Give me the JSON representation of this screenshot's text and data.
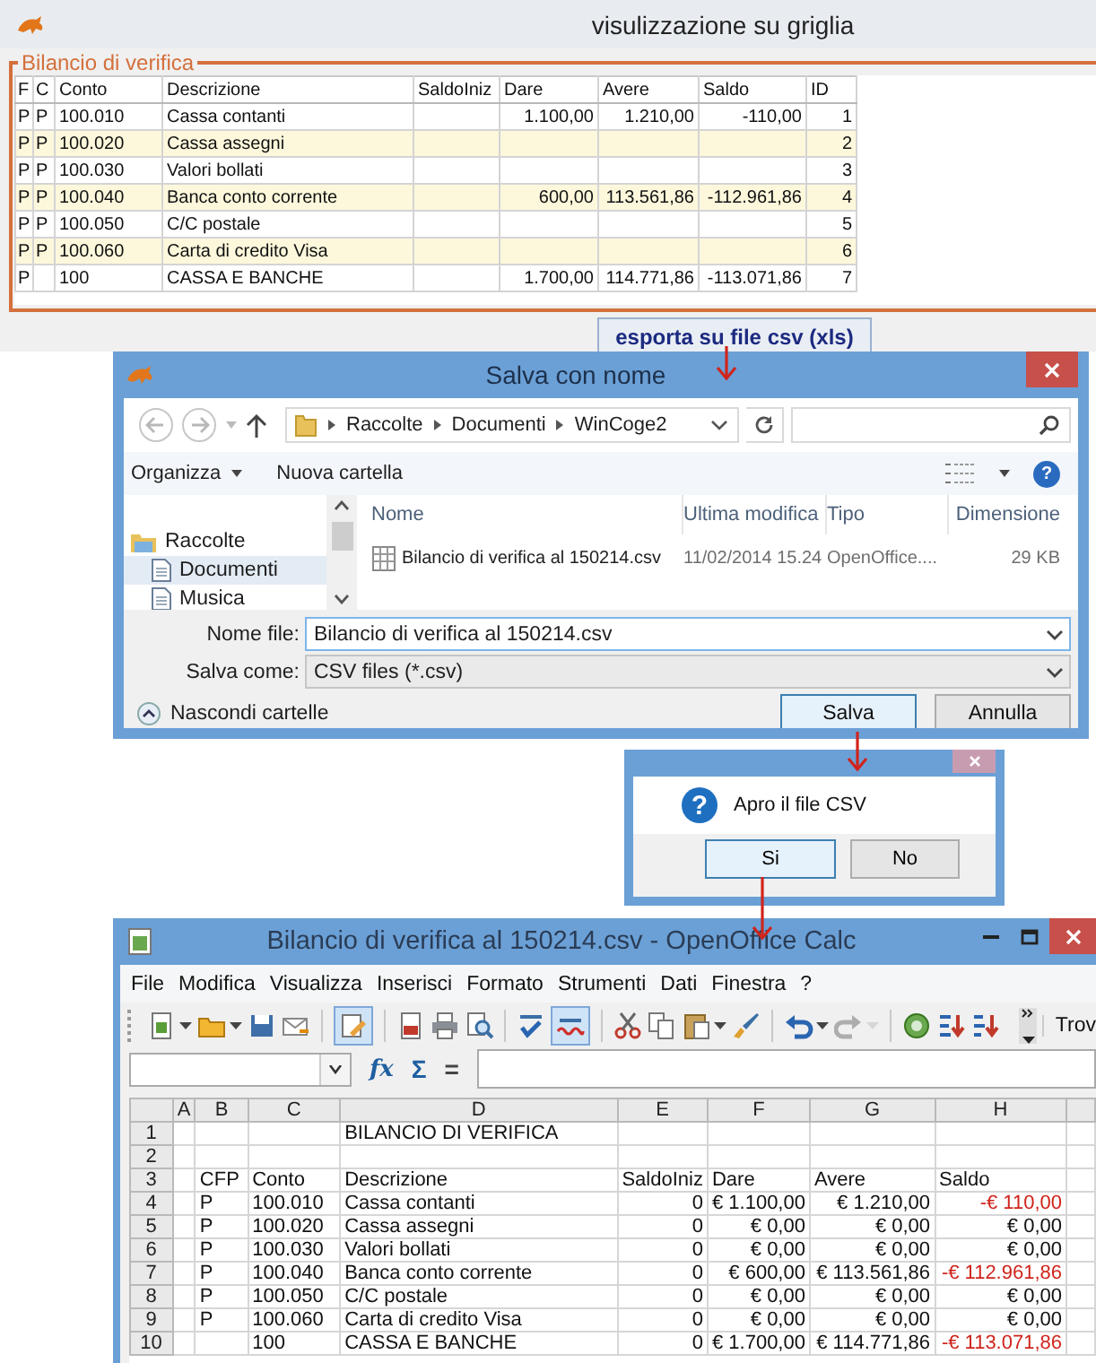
{
  "main_window": {
    "title": "visulizzazione su griglia",
    "group_title": "Bilancio di verifica",
    "columns": [
      "F",
      "C",
      "Conto",
      "Descrizione",
      "SaldoIniz",
      "Dare",
      "Avere",
      "Saldo",
      "ID"
    ],
    "rows": [
      {
        "f": "P",
        "c": "P",
        "conto": "100.010",
        "descrizione": "Cassa contanti",
        "dare": "1.100,00",
        "avere": "1.210,00",
        "saldo": "-110,00",
        "id": "1",
        "highlighted": false
      },
      {
        "f": "P",
        "c": "P",
        "conto": "100.020",
        "descrizione": "Cassa assegni",
        "id": "2",
        "highlighted": true
      },
      {
        "f": "P",
        "c": "P",
        "conto": "100.030",
        "descrizione": "Valori bollati",
        "id": "3",
        "highlighted": false
      },
      {
        "f": "P",
        "c": "P",
        "conto": "100.040",
        "descrizione": "Banca conto corrente",
        "dare": "600,00",
        "avere": "113.561,86",
        "saldo": "-112.961,86",
        "id": "4",
        "highlighted": true
      },
      {
        "f": "P",
        "c": "P",
        "conto": "100.050",
        "descrizione": "C/C postale",
        "id": "5",
        "highlighted": false
      },
      {
        "f": "P",
        "c": "P",
        "conto": "100.060",
        "descrizione": "Carta di credito Visa",
        "id": "6",
        "highlighted": true
      },
      {
        "f": "P",
        "conto": "100",
        "descrizione": "CASSA E BANCHE",
        "dare": "1.700,00",
        "avere": "114.771,86",
        "saldo": "-113.071,86",
        "id": "7",
        "highlighted": false
      }
    ],
    "export_button": "esporta su file csv (xls)"
  },
  "save_dialog": {
    "title": "Salva con nome",
    "path": [
      "Raccolte",
      "Documenti",
      "WinCoge2"
    ],
    "organize": "Organizza",
    "new_folder": "Nuova cartella",
    "help_glyph": "?",
    "nav": [
      {
        "label": "Raccolte",
        "selected": false,
        "children": [
          {
            "label": "Documenti",
            "selected": true
          },
          {
            "label": "Musica",
            "selected": false
          }
        ]
      }
    ],
    "file_columns": [
      "Nome",
      "Ultima modifica",
      "Tipo",
      "Dimensione"
    ],
    "files": [
      {
        "name": "Bilancio di verifica al 150214.csv",
        "modified": "11/02/2014 15.24",
        "type": "OpenOffice....",
        "size": "29 KB"
      }
    ],
    "file_name": {
      "label": "Nome file:",
      "value": "Bilancio di verifica al 150214.csv"
    },
    "save_as": {
      "label": "Salva come:",
      "value": "CSV files (*.csv)"
    },
    "hide_folders": "Nascondi cartelle",
    "buttons": [
      {
        "label": "Salva",
        "default": true
      },
      {
        "label": "Annulla",
        "default": false
      }
    ]
  },
  "message_box": {
    "icon_glyph": "?",
    "text": "Apro il file CSV",
    "buttons": [
      {
        "label": "Si",
        "default": true
      },
      {
        "label": "No",
        "default": false
      }
    ]
  },
  "calc_window": {
    "title": "Bilancio di verifica al 150214.csv - OpenOffice Calc",
    "menu": [
      "File",
      "Modifica",
      "Visualizza",
      "Inserisci",
      "Formato",
      "Strumenti",
      "Dati",
      "Finestra",
      "?"
    ],
    "toolbar": [
      {
        "kind": "new",
        "dropdown": true,
        "pressed": false,
        "disabled": false
      },
      {
        "kind": "open",
        "dropdown": true,
        "pressed": false,
        "disabled": false
      },
      {
        "kind": "save",
        "dropdown": false,
        "pressed": false,
        "disabled": false
      },
      {
        "kind": "mail",
        "dropdown": false,
        "pressed": false,
        "disabled": false
      },
      {
        "kind": "separator"
      },
      {
        "kind": "edit",
        "dropdown": false,
        "pressed": true,
        "disabled": false
      },
      {
        "kind": "separator"
      },
      {
        "kind": "pdf",
        "dropdown": false,
        "pressed": false,
        "disabled": false
      },
      {
        "kind": "print",
        "dropdown": false,
        "pressed": false,
        "disabled": false
      },
      {
        "kind": "preview",
        "dropdown": false,
        "pressed": false,
        "disabled": false
      },
      {
        "kind": "separator"
      },
      {
        "kind": "spell",
        "dropdown": false,
        "pressed": false,
        "disabled": false
      },
      {
        "kind": "autospell",
        "dropdown": false,
        "pressed": true,
        "disabled": false
      },
      {
        "kind": "separator"
      },
      {
        "kind": "cut",
        "dropdown": false,
        "pressed": false,
        "disabled": false
      },
      {
        "kind": "copy",
        "dropdown": false,
        "pressed": false,
        "disabled": false
      },
      {
        "kind": "paste",
        "dropdown": true,
        "pressed": false,
        "disabled": false
      },
      {
        "kind": "brush",
        "dropdown": false,
        "pressed": false,
        "disabled": false
      },
      {
        "kind": "separator"
      },
      {
        "kind": "undo",
        "dropdown": true,
        "pressed": false,
        "disabled": false
      },
      {
        "kind": "redo",
        "dropdown": true,
        "pressed": false,
        "disabled": true
      },
      {
        "kind": "separator"
      },
      {
        "kind": "navigator",
        "dropdown": false,
        "pressed": false,
        "disabled": false
      },
      {
        "kind": "sort-asc",
        "dropdown": false,
        "pressed": false,
        "disabled": false
      },
      {
        "kind": "sort-desc",
        "dropdown": false,
        "pressed": false,
        "disabled": false
      }
    ],
    "find_label": "Trov",
    "formula_bar": {
      "function_wizard": "fx",
      "sum": "Σ",
      "equals": "="
    },
    "columns": [
      "A",
      "B",
      "C",
      "D",
      "E",
      "F",
      "G",
      "H"
    ],
    "rows": [
      {
        "number": "1",
        "kind": "text",
        "d": "BILANCIO DI VERIFICA"
      },
      {
        "number": "2",
        "kind": "text"
      },
      {
        "number": "3",
        "kind": "text",
        "b": "CFP",
        "c": "Conto",
        "d": "Descrizione",
        "e": "SaldoIniz",
        "f": "Dare",
        "g": "Avere",
        "h": "Saldo"
      },
      {
        "number": "4",
        "kind": "values",
        "b": "P",
        "c": "100.010",
        "d": "Cassa contanti",
        "e": "0",
        "f": "€ 1.100,00",
        "g": "€ 1.210,00",
        "h": "-€ 110,00",
        "negative": true
      },
      {
        "number": "5",
        "kind": "values",
        "b": "P",
        "c": "100.020",
        "d": "Cassa assegni",
        "e": "0",
        "f": "€ 0,00",
        "g": "€ 0,00",
        "h": "€ 0,00",
        "negative": false
      },
      {
        "number": "6",
        "kind": "values",
        "b": "P",
        "c": "100.030",
        "d": "Valori bollati",
        "e": "0",
        "f": "€ 0,00",
        "g": "€ 0,00",
        "h": "€ 0,00",
        "negative": false
      },
      {
        "number": "7",
        "kind": "values",
        "b": "P",
        "c": "100.040",
        "d": "Banca conto corrente",
        "e": "0",
        "f": "€ 600,00",
        "g": "€ 113.561,86",
        "h": "-€ 112.961,86",
        "negative": true
      },
      {
        "number": "8",
        "kind": "values",
        "b": "P",
        "c": "100.050",
        "d": "C/C postale",
        "e": "0",
        "f": "€ 0,00",
        "g": "€ 0,00",
        "h": "€ 0,00",
        "negative": false
      },
      {
        "number": "9",
        "kind": "values",
        "b": "P",
        "c": "100.060",
        "d": "Carta di credito Visa",
        "e": "0",
        "f": "€ 0,00",
        "g": "€ 0,00",
        "h": "€ 0,00",
        "negative": false
      },
      {
        "number": "10",
        "kind": "values",
        "c": "100",
        "d": "CASSA E BANCHE",
        "e": "0",
        "f": "€ 1.700,00",
        "g": "€ 114.771,86",
        "h": "-€ 113.071,86",
        "negative": true
      }
    ]
  }
}
